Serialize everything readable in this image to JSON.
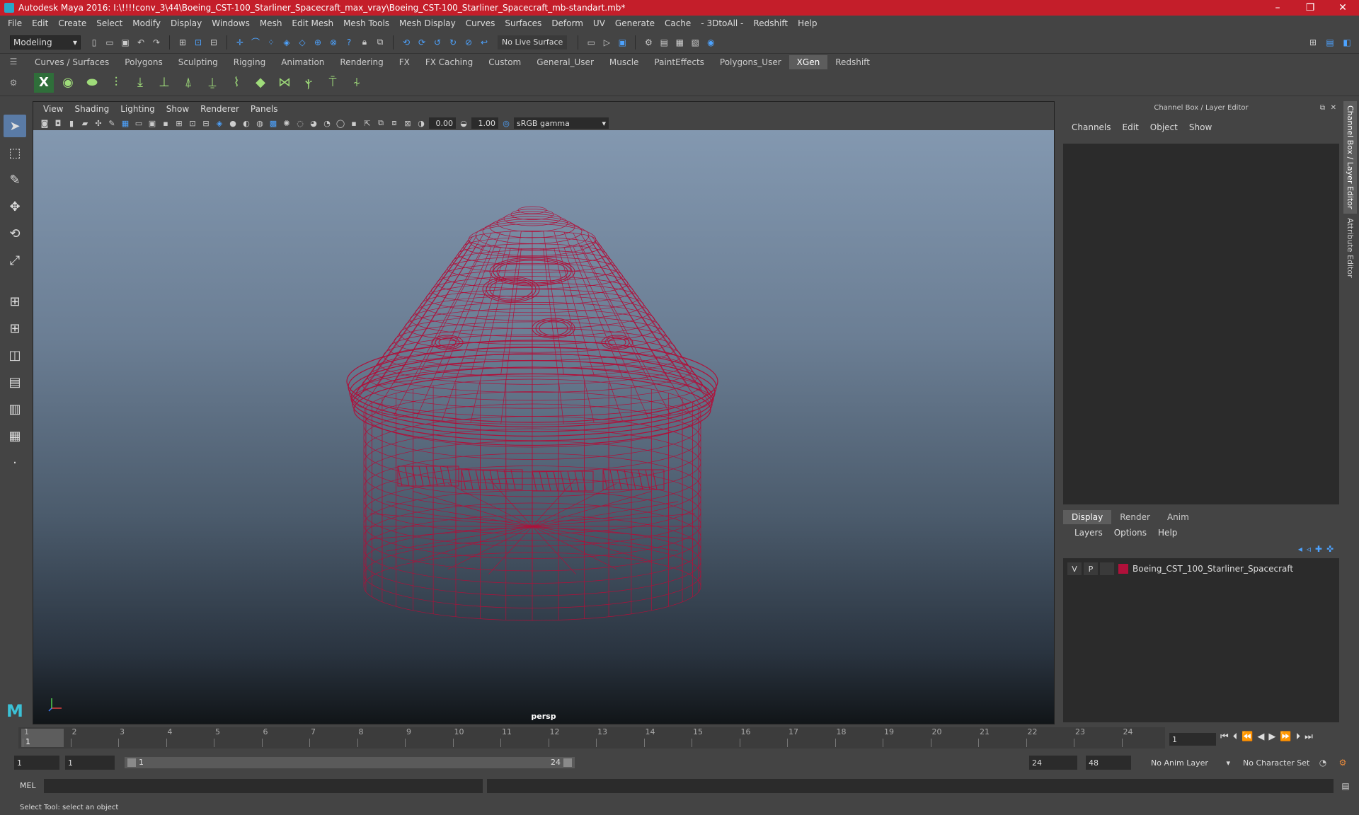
{
  "window": {
    "title": "Autodesk Maya 2016: I:\\!!!!conv_3\\44\\Boeing_CST-100_Starliner_Spacecraft_max_vray\\Boeing_CST-100_Starliner_Spacecraft_mb-standart.mb*",
    "controls": [
      "–",
      "❐",
      "✕"
    ]
  },
  "menubar": [
    "File",
    "Edit",
    "Create",
    "Select",
    "Modify",
    "Display",
    "Windows",
    "Mesh",
    "Edit Mesh",
    "Mesh Tools",
    "Mesh Display",
    "Curves",
    "Surfaces",
    "Deform",
    "UV",
    "Generate",
    "Cache",
    "- 3DtoAll -",
    "Redshift",
    "Help"
  ],
  "statusline": {
    "mode": "Modeling",
    "live_surface": "No Live Surface"
  },
  "shelf": {
    "tabs": [
      "Curves / Surfaces",
      "Polygons",
      "Sculpting",
      "Rigging",
      "Animation",
      "Rendering",
      "FX",
      "FX Caching",
      "Custom",
      "General_User",
      "Muscle",
      "PaintEffects",
      "Polygons_User",
      "XGen",
      "Redshift"
    ],
    "active_tab": "XGen"
  },
  "viewport": {
    "menu": [
      "View",
      "Shading",
      "Lighting",
      "Show",
      "Renderer",
      "Panels"
    ],
    "exposure": "0.00",
    "gamma_value": "1.00",
    "color_space": "sRGB gamma",
    "camera": "persp"
  },
  "channel_box": {
    "title": "Channel Box / Layer Editor",
    "menu": [
      "Channels",
      "Edit",
      "Object",
      "Show"
    ]
  },
  "layer_editor": {
    "tabs": [
      "Display",
      "Render",
      "Anim"
    ],
    "active_tab": "Display",
    "menu": [
      "Layers",
      "Options",
      "Help"
    ],
    "layers": [
      {
        "v": "V",
        "p": "P",
        "name": "Boeing_CST_100_Starliner_Spacecraft",
        "color": "#b0103a"
      }
    ]
  },
  "side_tabs": [
    "Channel Box / Layer Editor",
    "Attribute Editor"
  ],
  "timeline": {
    "ticks": [
      "1",
      "2",
      "3",
      "4",
      "5",
      "6",
      "7",
      "8",
      "9",
      "10",
      "11",
      "12",
      "13",
      "14",
      "15",
      "16",
      "17",
      "18",
      "19",
      "20",
      "21",
      "22",
      "23",
      "24"
    ],
    "current_frame": "1",
    "frame_field": "1"
  },
  "range": {
    "start": "1",
    "playback_start": "1",
    "range_start_label": "1",
    "range_end_label": "24",
    "playback_end": "24",
    "end": "48",
    "anim_layer": "No Anim Layer",
    "character_set": "No Character Set"
  },
  "command_line": {
    "label": "MEL"
  },
  "help_line": "Select Tool: select an object",
  "colors": {
    "title_bar": "#c41e2a",
    "wireframe": "#b0103a",
    "accent": "#5a7ba6"
  }
}
